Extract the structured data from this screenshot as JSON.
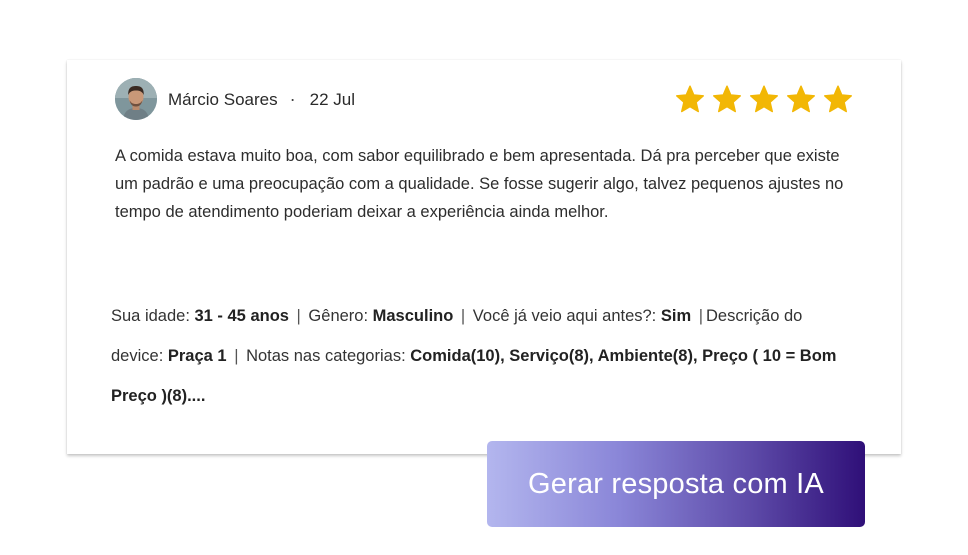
{
  "review": {
    "author": "Márcio Soares",
    "separator": "·",
    "date": "22 Jul",
    "rating": 5,
    "rating_max": 5,
    "star_color": "#f2b705",
    "text": "A comida estava muito boa, com sabor equilibrado e bem apresentada. Dá pra perceber que existe um padrão e uma preocupação com a qualidade. Se fosse sugerir algo, talvez pequenos ajustes no tempo de atendimento poderiam deixar a experiência ainda melhor."
  },
  "meta": {
    "age_label": "Sua idade: ",
    "age_value": "31 - 45 anos",
    "gender_label": " Gênero: ",
    "gender_value": "Masculino",
    "visited_label": " Você já veio aqui antes?: ",
    "visited_value": "Sim",
    "device_label": "Descrição do device: ",
    "device_value": "Praça 1",
    "categories_label": " Notas nas categorias: ",
    "categories_value": "Comida(10), Serviço(8), Ambiente(8), Preço ( 10 = Bom Preço )(8)....",
    "divider": "|"
  },
  "cta": {
    "label": "Gerar resposta com IA",
    "gradient_start": "#b3b6ee",
    "gradient_end": "#2f0f78"
  }
}
